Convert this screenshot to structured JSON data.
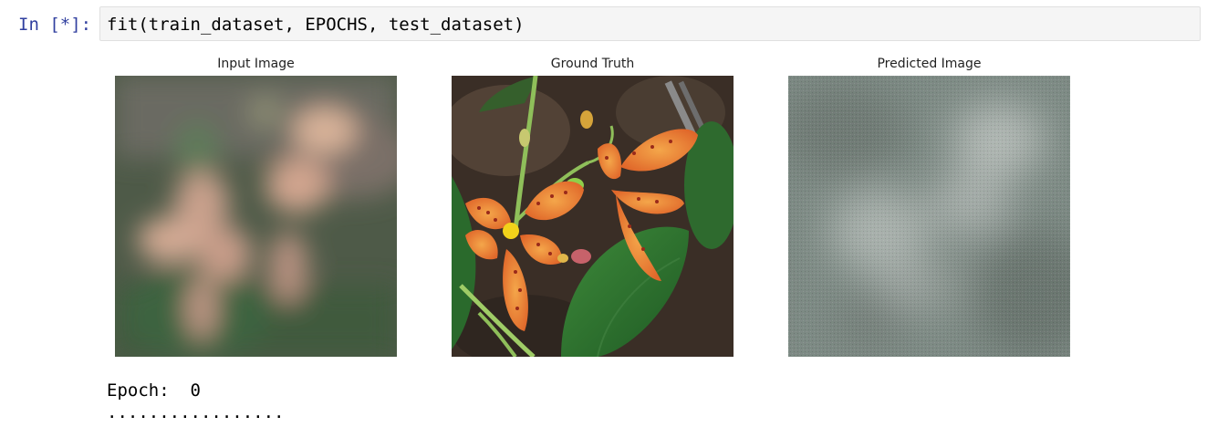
{
  "cell": {
    "prompt": "In [*]:",
    "code": "fit(train_dataset, EPOCHS, test_dataset)"
  },
  "output": {
    "panels": [
      {
        "title": "Input Image",
        "icon": "blurred-flower-image"
      },
      {
        "title": "Ground Truth",
        "icon": "lily-flower-photo"
      },
      {
        "title": "Predicted Image",
        "icon": "noisy-predicted-image"
      }
    ],
    "epoch_line": "Epoch:  0",
    "progress_dots": "................."
  }
}
